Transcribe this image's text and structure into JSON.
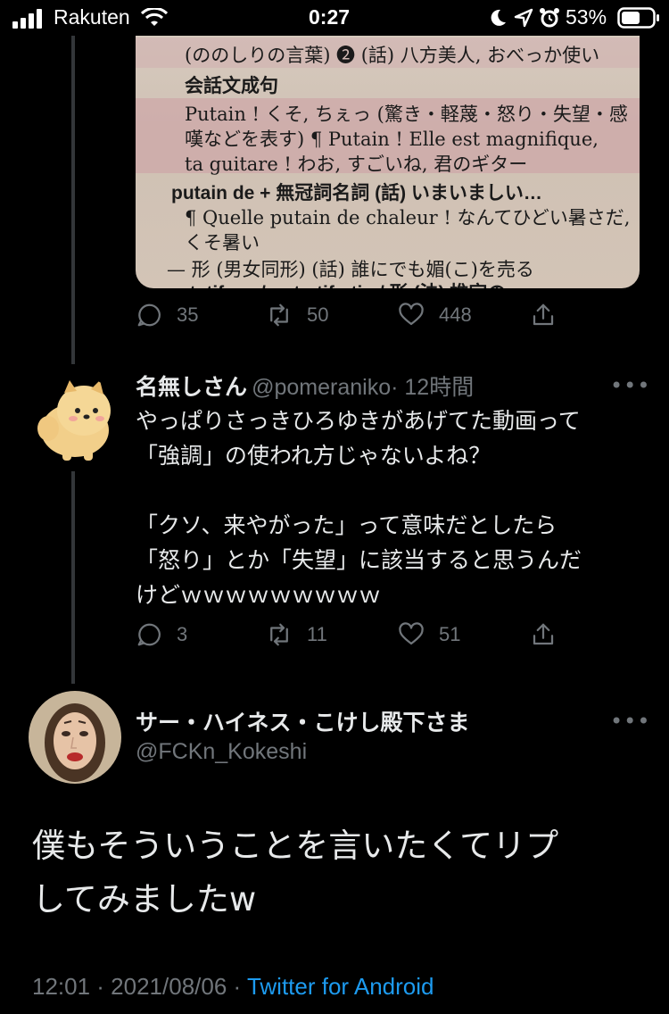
{
  "status_bar": {
    "carrier": "Rakuten",
    "time": "0:27",
    "battery_pct": "53%"
  },
  "dictionary_photo": {
    "lines": [
      "(ののしりの言葉) ❷ (話) 八方美人, おべっか使い",
      "会話文成句",
      "Putain ! くそ, ちぇっ (驚き・軽蔑・怒り・失望・感",
      "嘆などを表す) ¶ Putain ! Elle est magnifique,",
      "ta guitare ! わお, すごいね, 君のギター",
      "putain de + 無冠詞名詞 (話) いまいましい…",
      "¶ Quelle putain de chaleur ! なんてひどい暑さだ,",
      "くそ暑い",
      "— 形 (男女同形) (話) 誰にでも媚(こ)を売る",
      "putatif, ve /py-ta-tif, -tiːv/ 形 (法) 推定の"
    ]
  },
  "tweet_top_actions": {
    "replies": "35",
    "retweets": "50",
    "likes": "448"
  },
  "reply_tweet": {
    "name": "名無しさん",
    "handle": "@pomeraniko",
    "time": "· 12時間",
    "text": "やっぱりさっきひろゆきがあげてた動画って\n「強調」の使われ方じゃないよね？\n\n「クソ、来やがった」って意味だとしたら\n「怒り」とか「失望」に該当すると思うんだ\nけどｗｗｗｗｗｗｗｗｗ",
    "replies": "3",
    "retweets": "11",
    "likes": "51"
  },
  "main_tweet": {
    "name": "サー・ハイネス・こけし殿下さま",
    "handle": "@FCKn_Kokeshi",
    "text": "僕もそういうことを言いたくてリプ\nしてみましたw",
    "timestamp": "12:01 · 2021/08/06 · ",
    "source": "Twitter for Android"
  },
  "more_glyph": "•••",
  "colors": {
    "background": "#000000",
    "secondary_text": "#71767b",
    "link": "#1d9bf0"
  }
}
